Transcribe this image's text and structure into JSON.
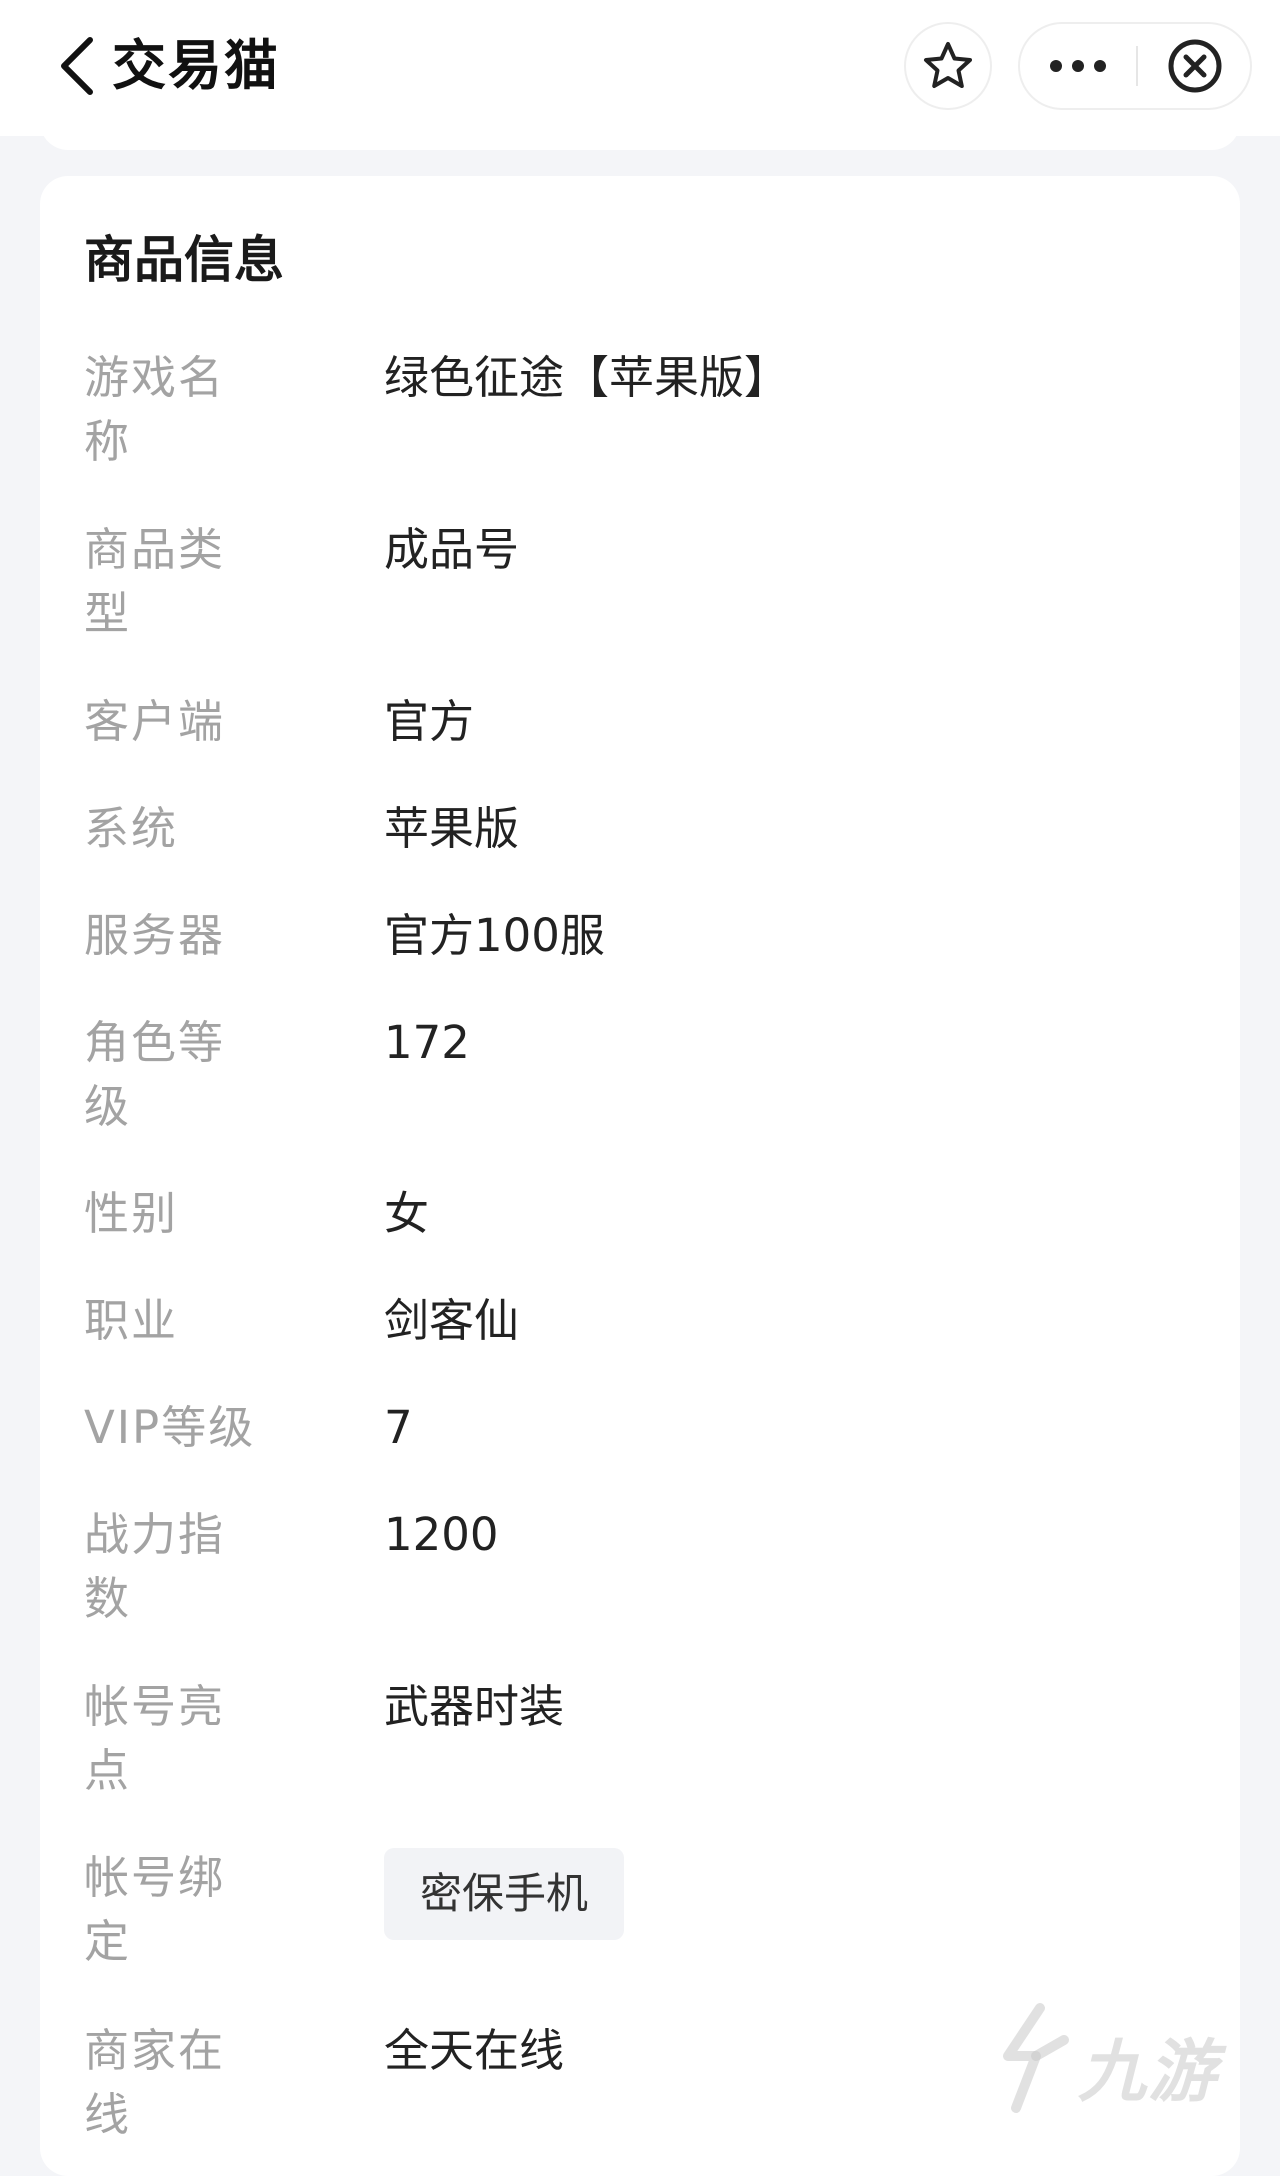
{
  "header": {
    "title": "交易猫"
  },
  "section": {
    "title": "商品信息"
  },
  "fields": [
    {
      "label": "游戏名称",
      "value": "绿色征途【苹果版】"
    },
    {
      "label": "商品类型",
      "value": "成品号"
    },
    {
      "label": "客户端",
      "value": "官方"
    },
    {
      "label": "系统",
      "value": "苹果版"
    },
    {
      "label": "服务器",
      "value": "官方100服"
    },
    {
      "label": "角色等级",
      "value": "172"
    },
    {
      "label": "性别",
      "value": "女"
    },
    {
      "label": "职业",
      "value": "剑客仙"
    },
    {
      "label": "VIP等级",
      "value": "7"
    },
    {
      "label": "战力指数",
      "value": "1200"
    },
    {
      "label": "帐号亮点",
      "value": "武器时装"
    },
    {
      "label": "帐号绑定",
      "value": "密保手机"
    },
    {
      "label": "商家在线",
      "value": "全天在线"
    }
  ],
  "watermark": {
    "text": "九游"
  },
  "icons": {
    "back": "chevron-left-icon",
    "favorite": "star-icon",
    "more": "more-dots-icon",
    "close": "close-circle-icon"
  }
}
